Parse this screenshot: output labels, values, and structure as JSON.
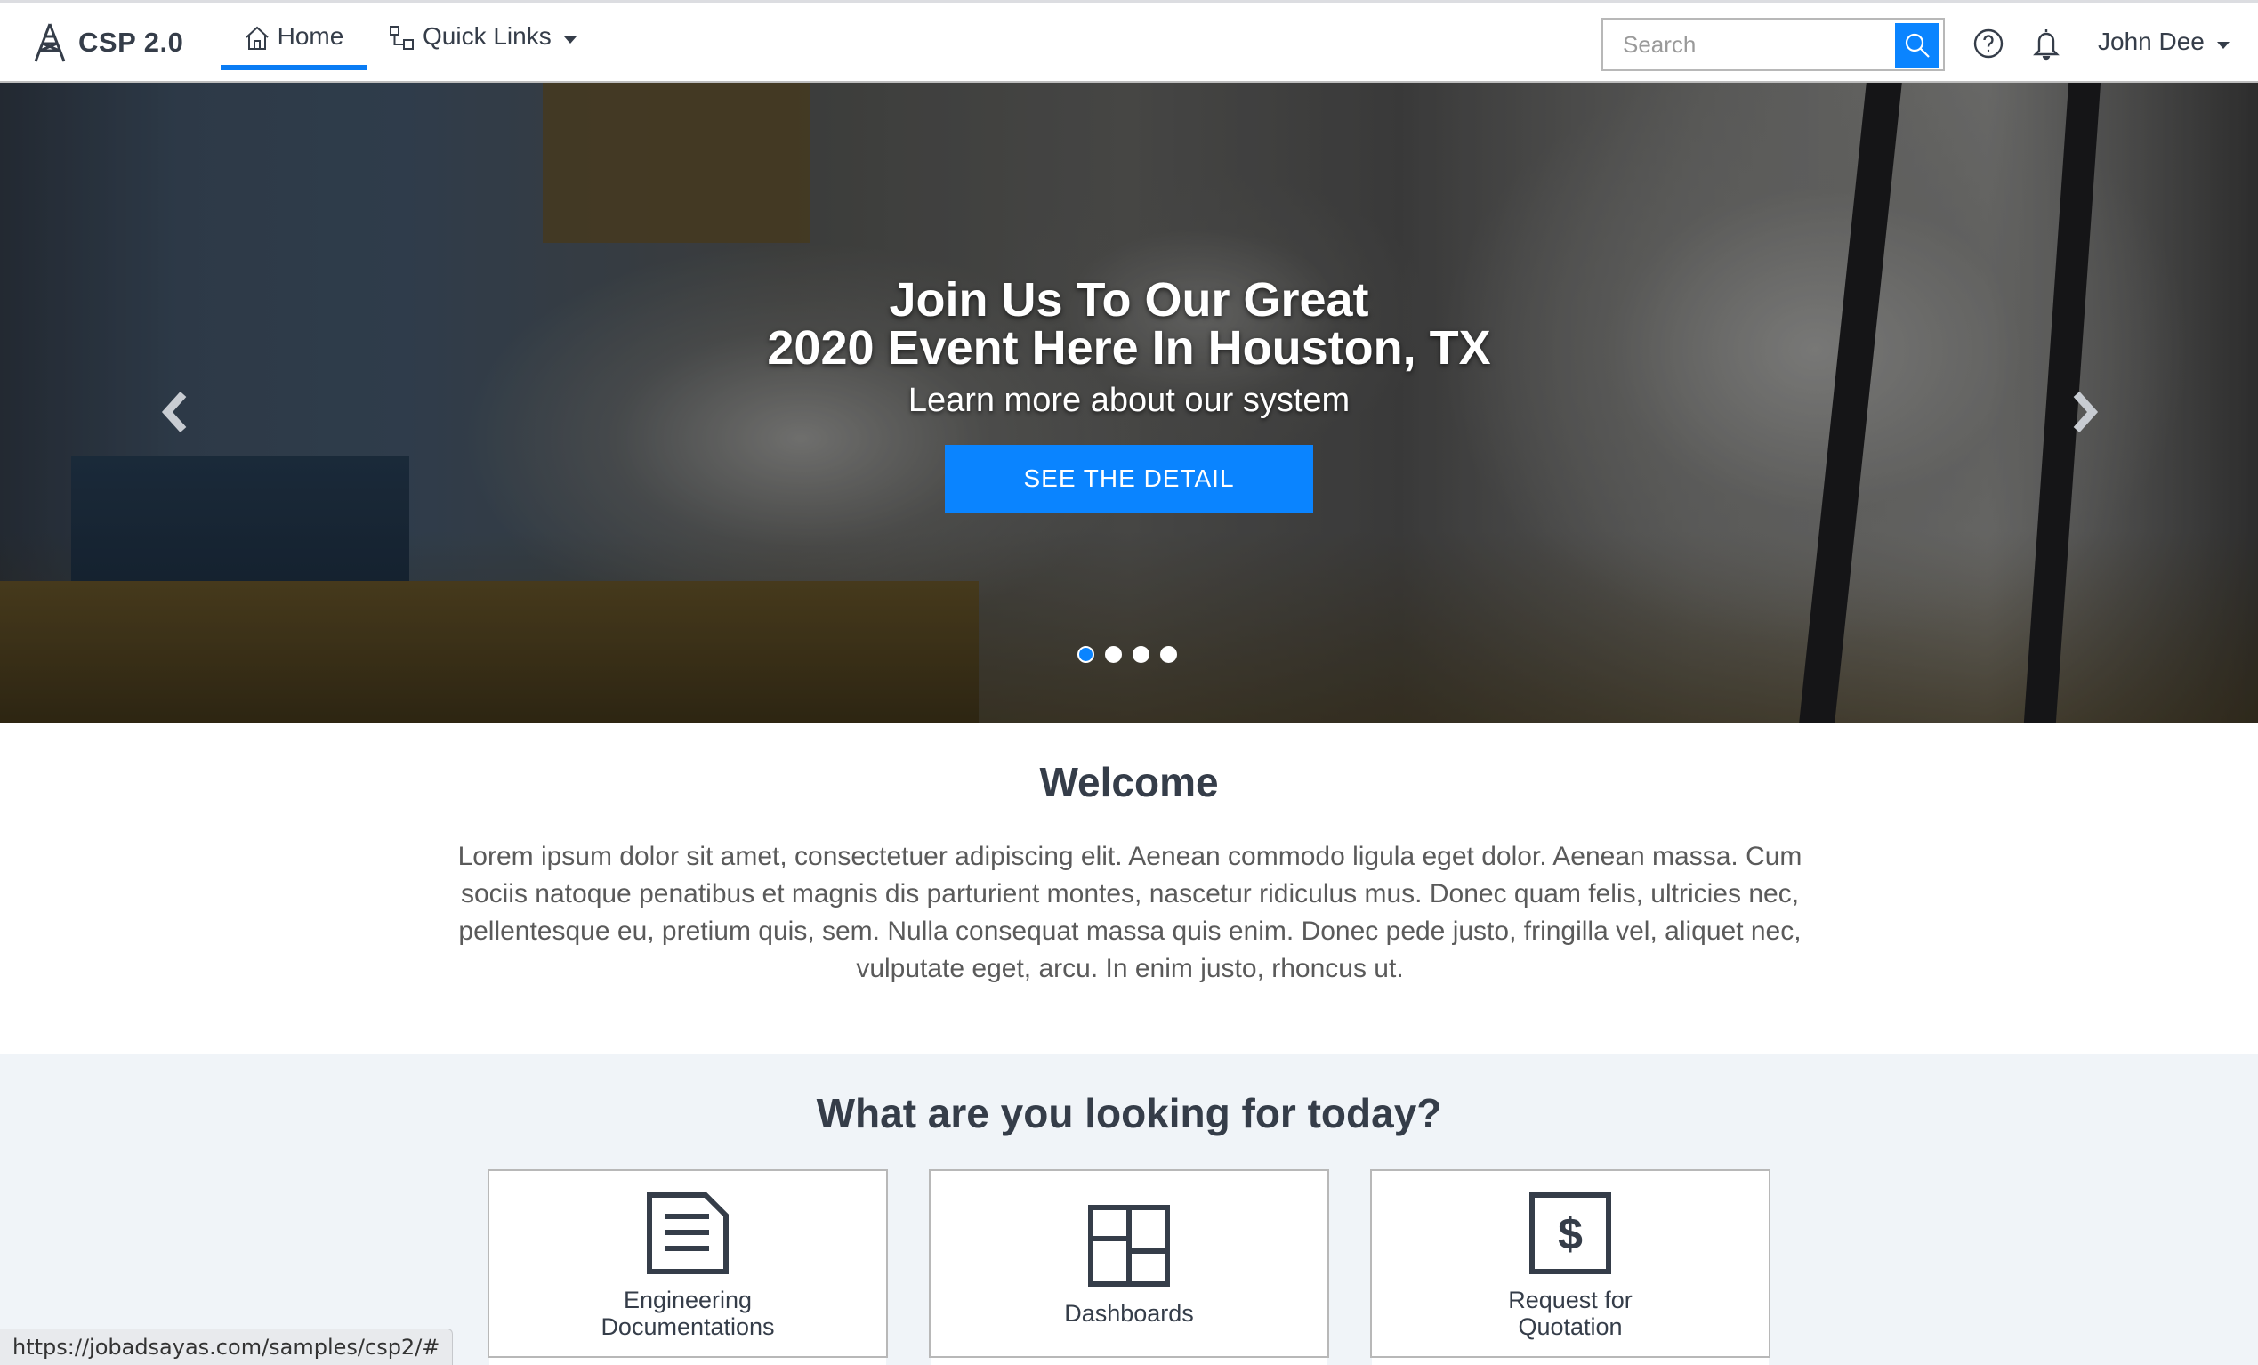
{
  "app": {
    "name": "CSP 2.0",
    "logo_icon": "tower-icon"
  },
  "nav": {
    "tabs": [
      {
        "label": "Home",
        "icon": "home-icon",
        "active": true
      },
      {
        "label": "Quick Links",
        "icon": "sitemap-icon",
        "has_dropdown": true
      }
    ]
  },
  "search": {
    "placeholder": "Search",
    "value": "",
    "button_icon": "search-icon"
  },
  "header_icons": {
    "help": "help-circle-icon",
    "notifications": "bell-icon"
  },
  "user": {
    "name": "John Dee"
  },
  "hero": {
    "title_line1": "Join Us To Our Great",
    "title_line2": "2020 Event Here In Houston, TX",
    "subtitle": "Learn more about our system",
    "button_label": "SEE THE DETAIL",
    "slide_count": 4,
    "active_slide": 1
  },
  "welcome": {
    "title": "Welcome",
    "text": "Lorem ipsum dolor sit amet, consectetuer adipiscing elit. Aenean commodo ligula eget dolor. Aenean massa. Cum sociis natoque penatibus et magnis dis parturient montes, nascetur ridiculus mus. Donec quam felis, ultricies nec, pellentesque eu, pretium quis, sem. Nulla consequat massa quis enim. Donec pede justo, fringilla vel, aliquet nec, vulputate eget, arcu. In enim justo, rhoncus ut."
  },
  "looking": {
    "title": "What are you looking for today?",
    "cards": [
      {
        "label_line1": "Engineering",
        "label_line2": "Documentations",
        "icon": "document-icon"
      },
      {
        "label_line1": "Dashboards",
        "label_line2": "",
        "icon": "dashboard-icon"
      },
      {
        "label_line1": "Request for",
        "label_line2": "Quotation",
        "icon": "dollar-document-icon"
      }
    ]
  },
  "status_bar": {
    "url": "https://jobadsayas.com/samples/csp2/#"
  },
  "colors": {
    "accent": "#0a84ff",
    "text": "#353d49",
    "section_bg": "#f0f4f8"
  }
}
